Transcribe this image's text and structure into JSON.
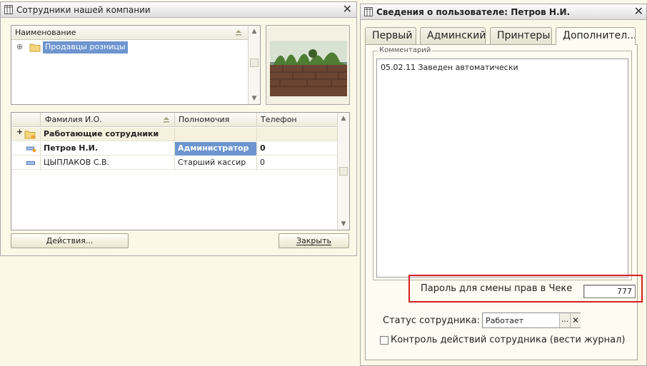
{
  "left_window": {
    "title": "Сотрудники  нашей компании",
    "tree": {
      "header": "Наименование",
      "items": [
        {
          "label": "Продавцы розницы",
          "expander": "⊕"
        }
      ]
    },
    "employees": {
      "columns": [
        "Фамилия И.О.",
        "Полномочия",
        "Телефон"
      ],
      "rows": [
        {
          "name": "Работающие сотрудники",
          "role": "",
          "phone": "",
          "type": "group",
          "marker": "+"
        },
        {
          "name": "Петров Н.И.",
          "role": "Администратор",
          "phone": "0",
          "type": "current"
        },
        {
          "name": "ЦЫПЛАКОВ С.В.",
          "role": "Старший кассир",
          "phone": "0",
          "type": "normal"
        }
      ]
    },
    "actions_button": "Действия...",
    "close_button": "Закрыть"
  },
  "right_window": {
    "title": "Сведения о пользователе: Петров Н.И.",
    "tabs": [
      "Первый",
      "Админский",
      "Принтеры",
      "Дополнител..."
    ],
    "active_tab": 3,
    "comment": {
      "legend": "Комментарий",
      "text": "05.02.11 Заведен автоматически"
    },
    "password": {
      "label": "Пароль для смены прав в Чеке",
      "value": "777"
    },
    "status": {
      "label": "Статус сотрудника:",
      "value": "Работает",
      "select_btn": "...",
      "clear_btn": "✕"
    },
    "log_checkbox": {
      "label": "Контроль действий сотрудника (вести журнал)",
      "checked": false
    }
  },
  "colors": {
    "background": "#fbf8e8",
    "selection": "#6d95cf",
    "highlight_border": "#d62020"
  },
  "icons": {
    "window": "table-icon",
    "close": "close-icon",
    "folder": "folder-icon",
    "group_row": "folder-group-icon",
    "current_row": "element-edit-icon",
    "normal_row": "element-icon",
    "photo": "aquarium-photo"
  }
}
